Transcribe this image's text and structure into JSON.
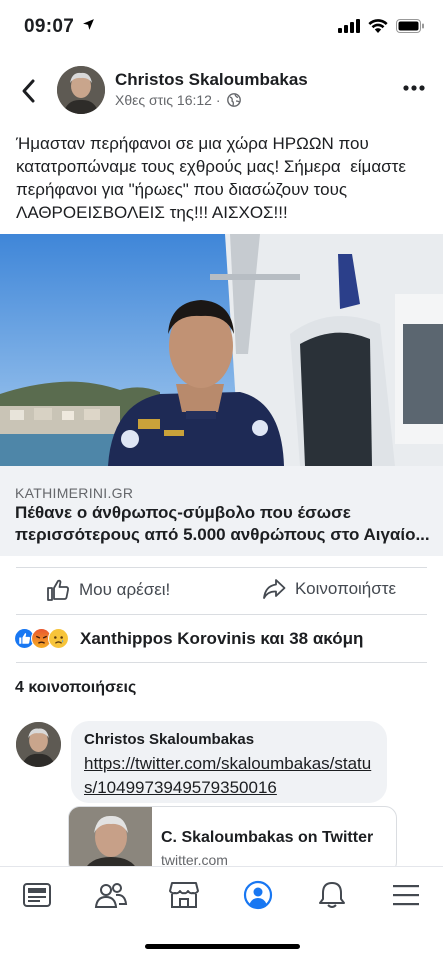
{
  "status_bar": {
    "time": "09:07",
    "location_icon": "location-arrow-icon",
    "signal_icon": "cellular-signal-icon",
    "wifi_icon": "wifi-icon",
    "battery_icon": "battery-icon"
  },
  "post": {
    "author": "Christos Skaloumbakas",
    "timestamp": "Χθες στις 16:12 ·",
    "audience_icon": "globe-icon",
    "text": "Ήμασταν περήφανοι σε μια χώρα ΗΡΩΩΝ που κατατροπώναμε τους εχθρούς μας! Σήμερα  είμαστε περήφανοι για \"ήρωες\" που διασώζουν τους ΛΑΘΡΟΕΙΣΒΟΛΕΙΣ της!!! ΑΙΣΧΟΣ!!!",
    "link": {
      "source": "KATHIMERINI.GR",
      "title": "Πέθανε ο άνθρωπος-σύμβολο που έσωσε περισσότερους από 5.000 ανθρώπους στο Αιγαίο..."
    }
  },
  "actions": {
    "like": "Μου αρέσει!",
    "share": "Κοινοποιήστε"
  },
  "reactions": {
    "icons": [
      "like-reaction-icon",
      "angry-reaction-icon",
      "sad-reaction-icon"
    ],
    "summary": "Xanthippos Korovinis και 38 ακόμη"
  },
  "shares_count": "4 κοινοποιήσεις",
  "comment": {
    "author": "Christos Skaloumbakas",
    "text": "https://twitter.com/skaloumbakas/status/1049973949579350016",
    "card": {
      "title": "C. Skaloumbakas on Twitter",
      "domain": "twitter.com"
    }
  },
  "tabbar": {
    "items": [
      "news-feed-icon",
      "friends-icon",
      "marketplace-icon",
      "profile-icon",
      "notifications-icon",
      "menu-icon"
    ],
    "active": "profile-icon"
  },
  "colors": {
    "accent": "#1877f2",
    "text": "#1c1e21",
    "secondary": "#65676b",
    "divider": "#dadde1"
  }
}
